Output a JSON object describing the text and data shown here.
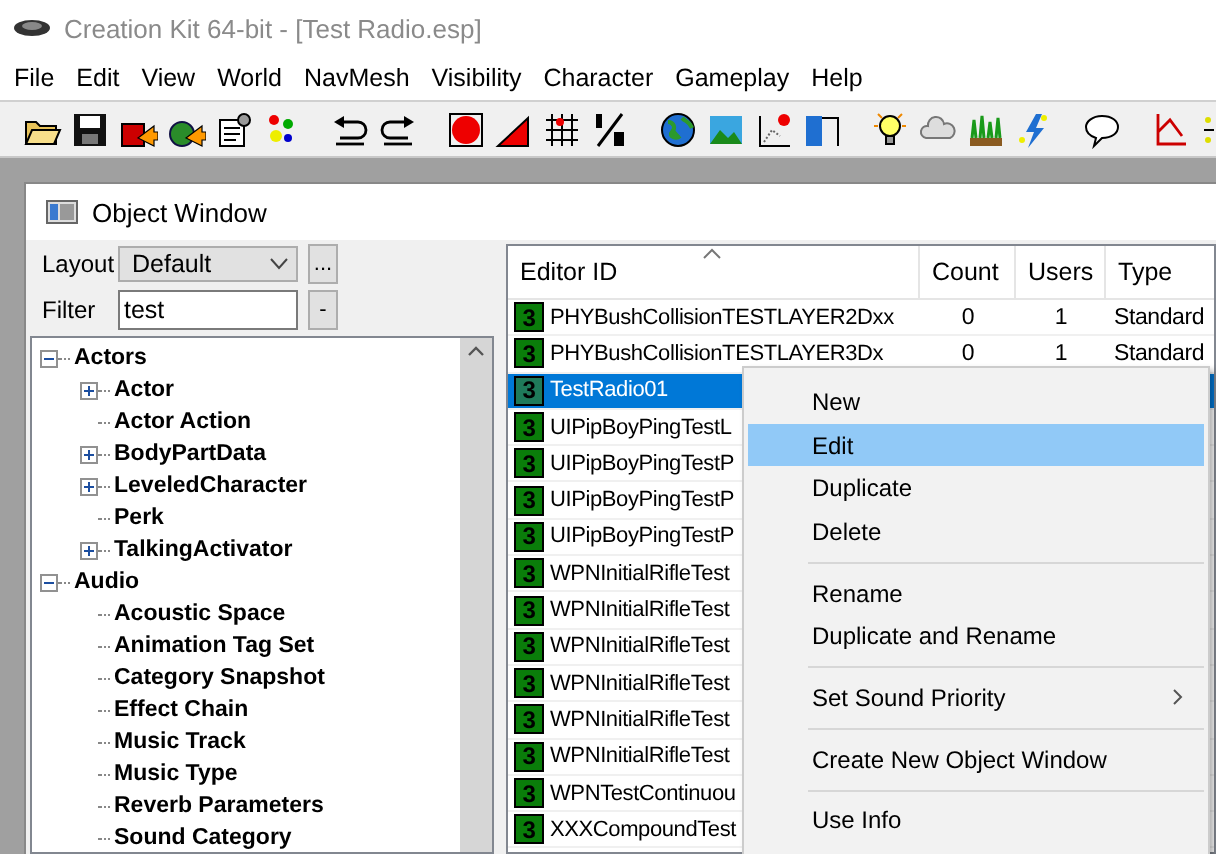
{
  "window": {
    "title": "Creation Kit 64-bit - [Test Radio.esp]"
  },
  "menu_bar": [
    "File",
    "Edit",
    "View",
    "World",
    "NavMesh",
    "Visibility",
    "Character",
    "Gameplay",
    "Help"
  ],
  "object_window": {
    "title": "Object Window",
    "layout": {
      "label": "Layout",
      "value": "Default",
      "button": "..."
    },
    "filter": {
      "label": "Filter",
      "value": "test",
      "button": "-"
    },
    "tree": [
      {
        "label": "Actors",
        "kind": "group",
        "expanded": true,
        "children": [
          {
            "label": "Actor",
            "kind": "group",
            "expanded": false
          },
          {
            "label": "Actor Action",
            "kind": "leaf"
          },
          {
            "label": "BodyPartData",
            "kind": "group",
            "expanded": false
          },
          {
            "label": "LeveledCharacter",
            "kind": "group",
            "expanded": false
          },
          {
            "label": "Perk",
            "kind": "leaf"
          },
          {
            "label": "TalkingActivator",
            "kind": "group",
            "expanded": false
          }
        ]
      },
      {
        "label": "Audio",
        "kind": "group",
        "expanded": true,
        "children": [
          {
            "label": "Acoustic Space",
            "kind": "leaf"
          },
          {
            "label": "Animation Tag Set",
            "kind": "leaf"
          },
          {
            "label": "Category Snapshot",
            "kind": "leaf"
          },
          {
            "label": "Effect Chain",
            "kind": "leaf"
          },
          {
            "label": "Music Track",
            "kind": "leaf"
          },
          {
            "label": "Music Type",
            "kind": "leaf"
          },
          {
            "label": "Reverb Parameters",
            "kind": "leaf"
          },
          {
            "label": "Sound Category",
            "kind": "leaf"
          }
        ]
      }
    ],
    "list": {
      "columns": [
        "Editor ID",
        "Count",
        "Users",
        "Type"
      ],
      "rows": [
        {
          "badge": "3",
          "editor_id": "PHYBushCollisionTESTLAYER2Dxx",
          "count": "0",
          "users": "1",
          "type": "Standard",
          "selected": false
        },
        {
          "badge": "3",
          "editor_id": "PHYBushCollisionTESTLAYER3Dx",
          "count": "0",
          "users": "1",
          "type": "Standard",
          "selected": false
        },
        {
          "badge": "3",
          "editor_id": "TestRadio01",
          "selected": true
        },
        {
          "badge": "3",
          "editor_id": "UIPipBoyPingTestL",
          "selected": false
        },
        {
          "badge": "3",
          "editor_id": "UIPipBoyPingTestP",
          "selected": false
        },
        {
          "badge": "3",
          "editor_id": "UIPipBoyPingTestP",
          "selected": false
        },
        {
          "badge": "3",
          "editor_id": "UIPipBoyPingTestP",
          "selected": false
        },
        {
          "badge": "3",
          "editor_id": "WPNInitialRifleTest",
          "selected": false
        },
        {
          "badge": "3",
          "editor_id": "WPNInitialRifleTest",
          "selected": false
        },
        {
          "badge": "3",
          "editor_id": "WPNInitialRifleTest",
          "selected": false
        },
        {
          "badge": "3",
          "editor_id": "WPNInitialRifleTest",
          "selected": false
        },
        {
          "badge": "3",
          "editor_id": "WPNInitialRifleTest",
          "selected": false
        },
        {
          "badge": "3",
          "editor_id": "WPNInitialRifleTest",
          "selected": false
        },
        {
          "badge": "3",
          "editor_id": "WPNTestContinuou",
          "selected": false
        },
        {
          "badge": "3",
          "editor_id": "XXXCompoundTest",
          "selected": false
        }
      ]
    }
  },
  "context_menu": {
    "groups": [
      [
        {
          "label": "New",
          "selected": false,
          "submenu": false
        },
        {
          "label": "Edit",
          "selected": true,
          "submenu": false
        },
        {
          "label": "Duplicate",
          "selected": false,
          "submenu": false
        },
        {
          "label": "Delete",
          "selected": false,
          "submenu": false
        }
      ],
      [
        {
          "label": "Rename",
          "selected": false,
          "submenu": false
        },
        {
          "label": "Duplicate and Rename",
          "selected": false,
          "submenu": false
        }
      ],
      [
        {
          "label": "Set Sound Priority",
          "selected": false,
          "submenu": true
        }
      ],
      [
        {
          "label": "Create New Object Window",
          "selected": false,
          "submenu": false
        }
      ],
      [
        {
          "label": "Use Info",
          "selected": false,
          "submenu": false
        }
      ]
    ]
  }
}
